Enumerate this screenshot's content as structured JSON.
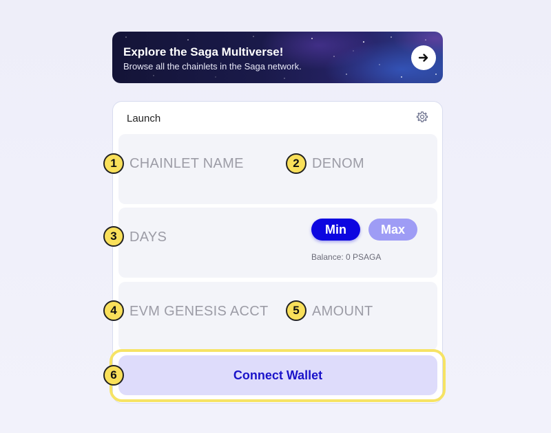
{
  "banner": {
    "title": "Explore the Saga Multiverse!",
    "subtitle": "Browse all the chainlets in the Saga network."
  },
  "launch": {
    "title": "Launch",
    "fields": {
      "chainlet_name": "CHAINLET NAME",
      "denom": "DENOM",
      "days": "DAYS",
      "evm_genesis_acct": "EVM GENESIS ACCT",
      "amount": "AMOUNT"
    },
    "min_label": "Min",
    "max_label": "Max",
    "balance": "Balance: 0 PSAGA",
    "connect_label": "Connect Wallet"
  },
  "badges": [
    "1",
    "2",
    "3",
    "4",
    "5",
    "6"
  ],
  "colors": {
    "accent": "#0c06e0",
    "accent_light": "#9e9cf5",
    "connect_bg": "#dedcfb",
    "badge": "#f9e05a",
    "highlight": "#f6e364"
  }
}
